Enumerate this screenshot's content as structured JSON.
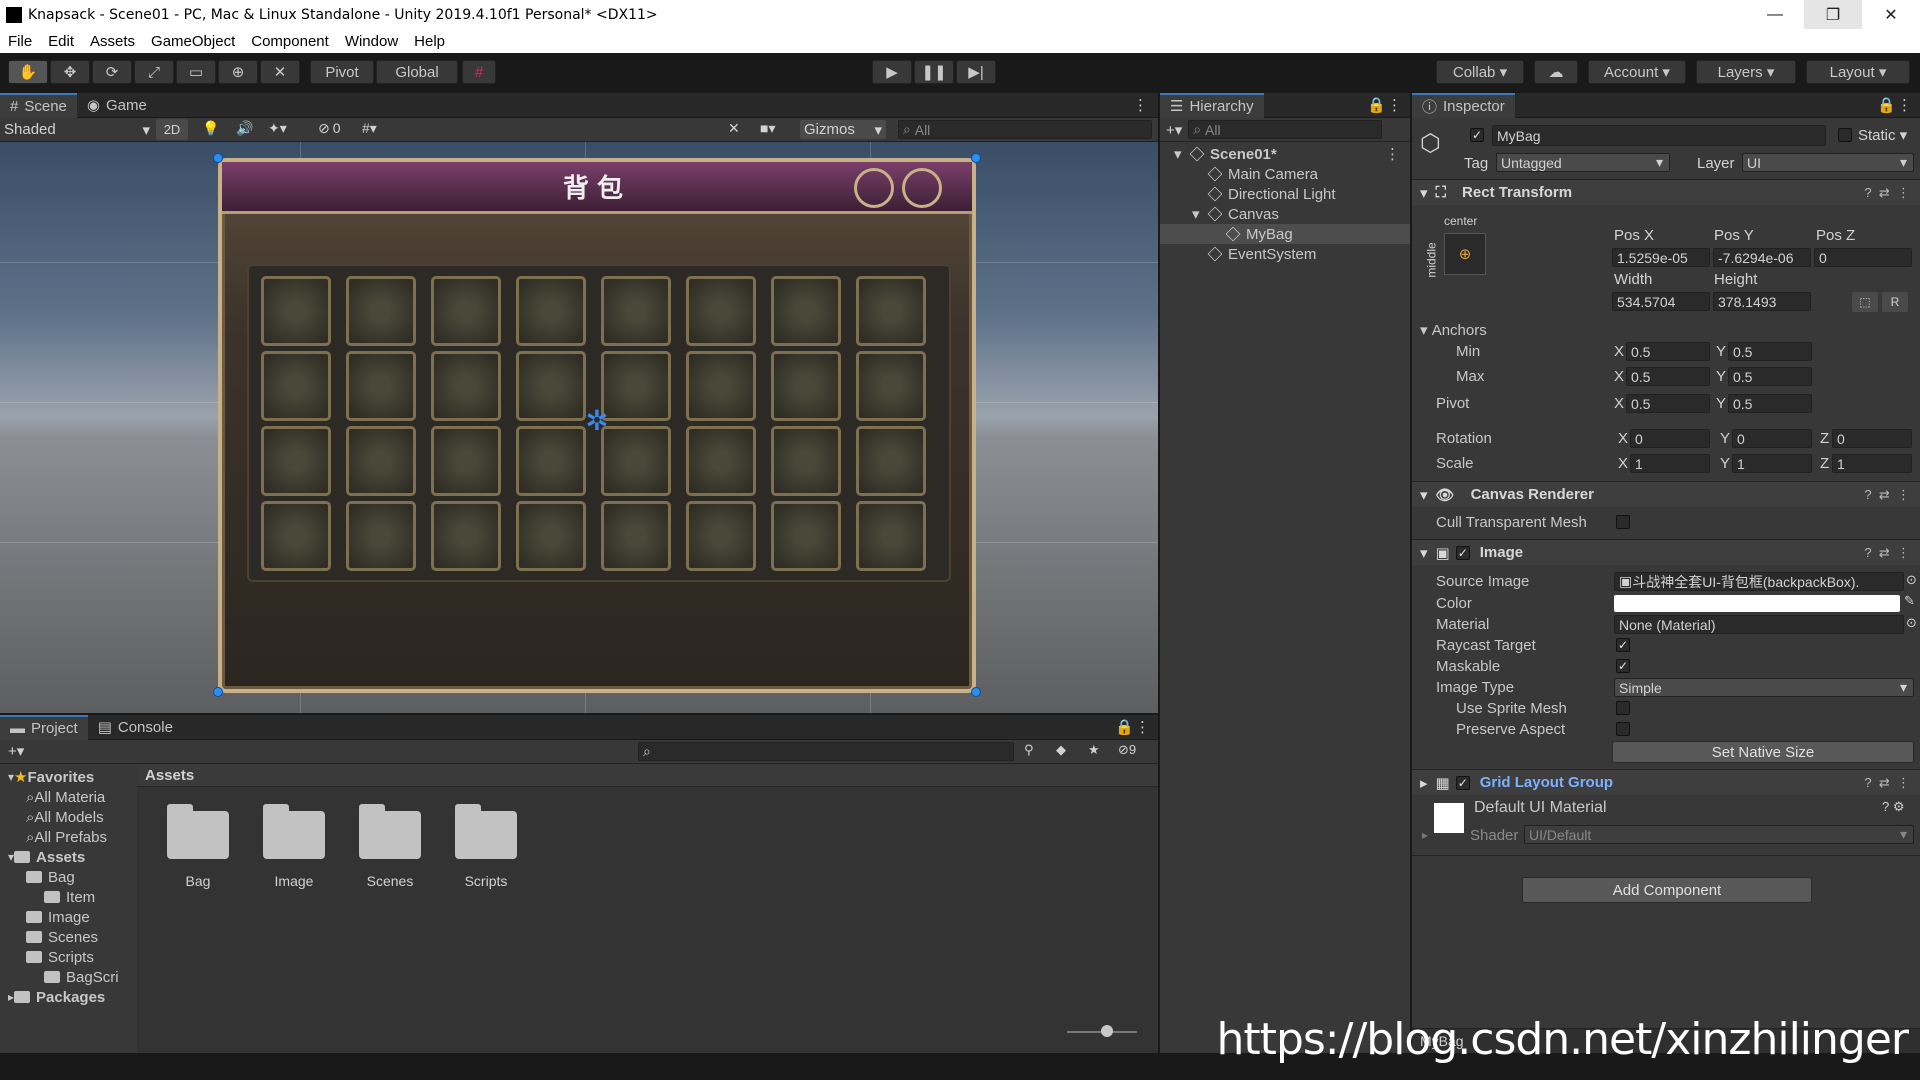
{
  "window": {
    "title": "Knapsack - Scene01 - PC, Mac & Linux Standalone - Unity 2019.4.10f1 Personal* <DX11>",
    "buttons": [
      "—",
      "❐",
      "✕"
    ]
  },
  "menu": [
    "File",
    "Edit",
    "Assets",
    "GameObject",
    "Component",
    "Window",
    "Help"
  ],
  "toolbar": {
    "pivot": "Pivot",
    "global": "Global",
    "collab": "Collab",
    "account": "Account",
    "layers": "Layers",
    "layout": "Layout"
  },
  "scene": {
    "tabs": [
      "Scene",
      "Game"
    ],
    "shading": "Shaded",
    "mode_2d": "2D",
    "hidden_count": "0",
    "gizmos": "Gizmos",
    "search_placeholder": "All",
    "bag_title": "背包",
    "grid_rows": 4,
    "grid_cols": 8
  },
  "hierarchy": {
    "title": "Hierarchy",
    "search_placeholder": "All",
    "items": [
      {
        "label": "Scene01*",
        "depth": 0,
        "type": "scene"
      },
      {
        "label": "Main Camera",
        "depth": 1,
        "type": "object"
      },
      {
        "label": "Directional Light",
        "depth": 1,
        "type": "object"
      },
      {
        "label": "Canvas",
        "depth": 1,
        "type": "object"
      },
      {
        "label": "MyBag",
        "depth": 2,
        "type": "object",
        "selected": true
      },
      {
        "label": "EventSystem",
        "depth": 1,
        "type": "object"
      }
    ]
  },
  "inspector": {
    "title": "Inspector",
    "object_name": "MyBag",
    "static_label": "Static",
    "tag_label": "Tag",
    "tag_value": "Untagged",
    "layer_label": "Layer",
    "layer_value": "UI",
    "rect_transform": {
      "title": "Rect Transform",
      "anchor_preset_top": "center",
      "anchor_preset_side": "middle",
      "pos_x_label": "Pos X",
      "pos_x": "1.5259e-05",
      "pos_y_label": "Pos Y",
      "pos_y": "-7.6294e-06",
      "pos_z_label": "Pos Z",
      "pos_z": "0",
      "width_label": "Width",
      "width": "534.5704",
      "height_label": "Height",
      "height": "378.1493",
      "anchors_label": "Anchors",
      "min_label": "Min",
      "min_x": "0.5",
      "min_y": "0.5",
      "max_label": "Max",
      "max_x": "0.5",
      "max_y": "0.5",
      "pivot_label": "Pivot",
      "pivot_x": "0.5",
      "pivot_y": "0.5",
      "rotation_label": "Rotation",
      "rot_x": "0",
      "rot_y": "0",
      "rot_z": "0",
      "scale_label": "Scale",
      "scale_x": "1",
      "scale_y": "1",
      "scale_z": "1",
      "r_button": "R"
    },
    "canvas_renderer": {
      "title": "Canvas Renderer",
      "cull_label": "Cull Transparent Mesh"
    },
    "image": {
      "title": "Image",
      "source_image_label": "Source Image",
      "source_image_value": "斗战神全套UI-背包框(backpackBox).",
      "color_label": "Color",
      "color_value": "#ffffff",
      "material_label": "Material",
      "material_value": "None (Material)",
      "raycast_label": "Raycast Target",
      "maskable_label": "Maskable",
      "image_type_label": "Image Type",
      "image_type_value": "Simple",
      "use_sprite_mesh_label": "Use Sprite Mesh",
      "preserve_aspect_label": "Preserve Aspect",
      "set_native_size": "Set Native Size"
    },
    "grid_layout_group": {
      "title": "Grid Layout Group"
    },
    "material": {
      "name": "Default UI Material",
      "shader_label": "Shader",
      "shader_value": "UI/Default"
    },
    "add_component": "Add Component",
    "footer": "MyBag"
  },
  "project": {
    "tabs": [
      "Project",
      "Console"
    ],
    "hidden_count": "9",
    "breadcrumb": "Assets",
    "tree": [
      {
        "label": "Favorites",
        "depth": 0,
        "type": "favorites"
      },
      {
        "label": "All Materia",
        "depth": 1,
        "type": "search"
      },
      {
        "label": "All Models",
        "depth": 1,
        "type": "search"
      },
      {
        "label": "All Prefabs",
        "depth": 1,
        "type": "search"
      },
      {
        "label": "Assets",
        "depth": 0,
        "type": "folder"
      },
      {
        "label": "Bag",
        "depth": 1,
        "type": "folder"
      },
      {
        "label": "Item",
        "depth": 2,
        "type": "folder"
      },
      {
        "label": "Image",
        "depth": 1,
        "type": "folder"
      },
      {
        "label": "Scenes",
        "depth": 1,
        "type": "folder"
      },
      {
        "label": "Scripts",
        "depth": 1,
        "type": "folder"
      },
      {
        "label": "BagScri",
        "depth": 2,
        "type": "folder"
      },
      {
        "label": "Packages",
        "depth": 0,
        "type": "folder"
      }
    ],
    "assets": [
      "Bag",
      "Image",
      "Scenes",
      "Scripts"
    ]
  },
  "watermark": "https://blog.csdn.net/xinzhilinger",
  "colors": {
    "accent": "#3a79bb",
    "panel": "#383838",
    "selection": "#4d4d4d",
    "handle": "#2c8ef0"
  }
}
